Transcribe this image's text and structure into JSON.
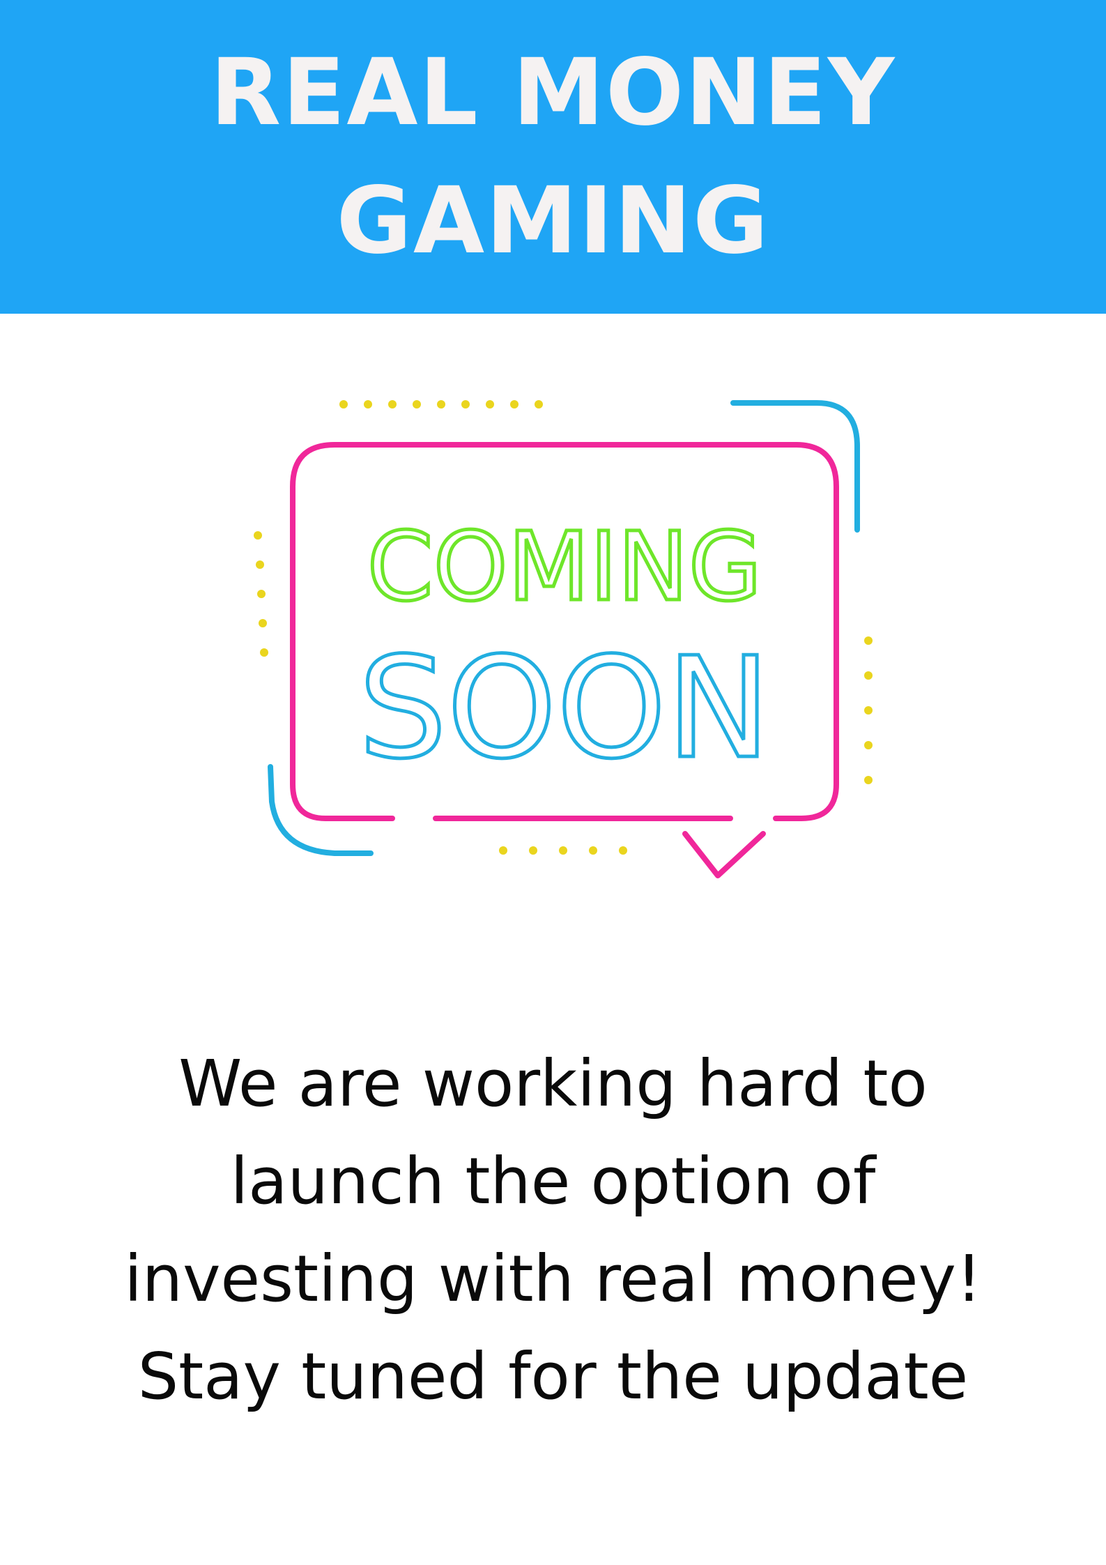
{
  "header": {
    "title_line1": "REAL MONEY",
    "title_line2": "GAMING",
    "background_color": "#1fa5f5",
    "text_color": "#f5f2f2"
  },
  "sign": {
    "line1": "COMING",
    "line2": "SOON",
    "colors": {
      "frame": "#f0279a",
      "line1": "#6ee62a",
      "line2": "#22aee0",
      "accents": "#22aee0",
      "dots": "#ead51e"
    }
  },
  "message": {
    "lines": [
      "We are working hard to",
      "launch the option of",
      "investing with real money!",
      "Stay tuned for the update"
    ]
  }
}
